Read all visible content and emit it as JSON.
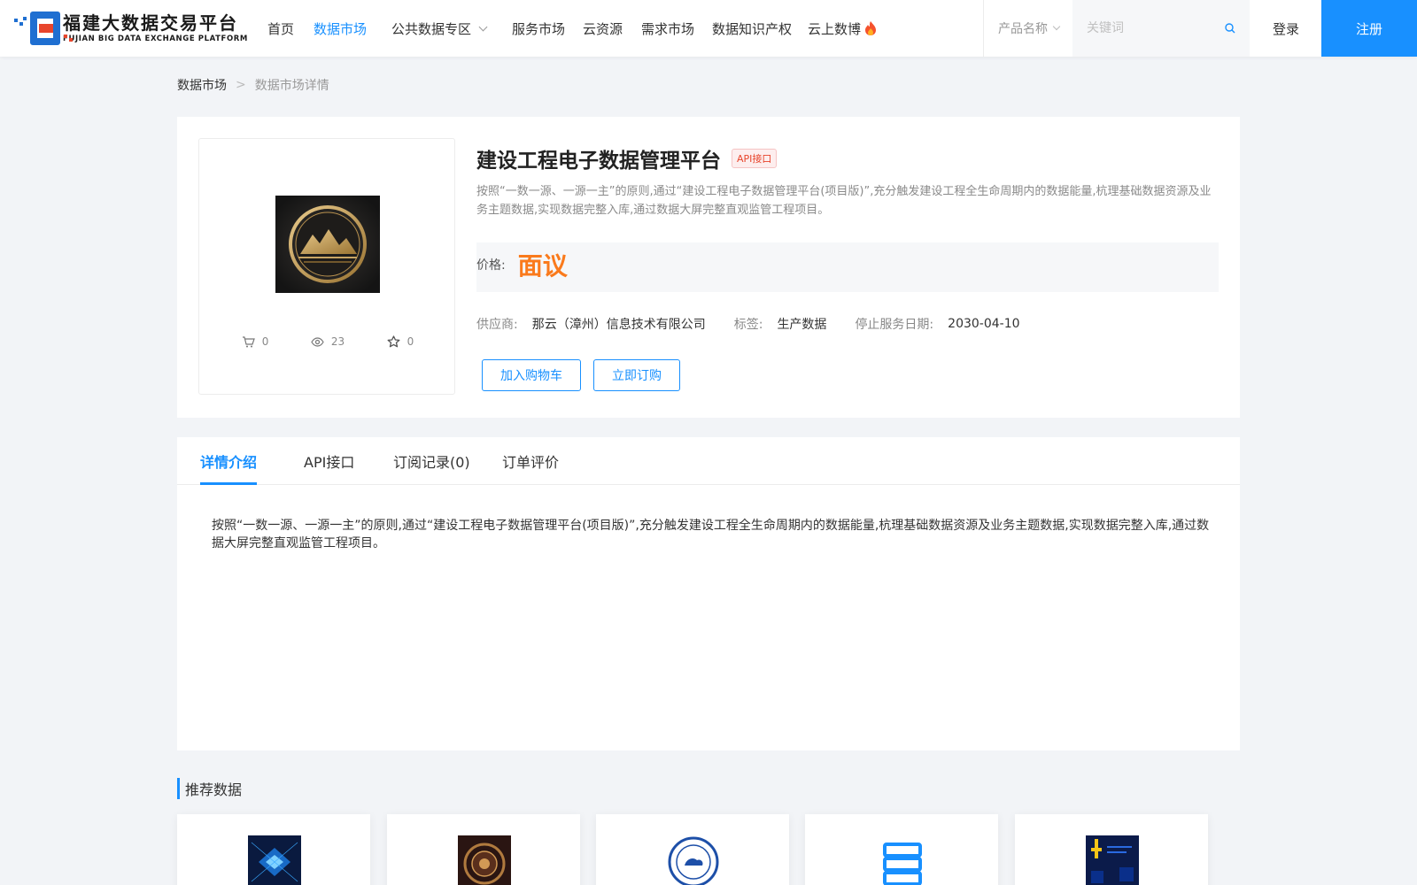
{
  "brand": {
    "name_cn": "福建大数据交易平台",
    "name_en": "FUJIAN BIG DATA EXCHANGE  PLATFORM",
    "primary_color": "#1f6fd1",
    "accent_color": "#e8452c"
  },
  "nav": {
    "items": [
      {
        "label": "首页",
        "active": false
      },
      {
        "label": "数据市场",
        "active": true
      },
      {
        "label": "公共数据专区",
        "active": false,
        "has_dropdown": true
      },
      {
        "label": "服务市场",
        "active": false
      },
      {
        "label": "云资源",
        "active": false
      },
      {
        "label": "需求市场",
        "active": false
      },
      {
        "label": "数据知识产权",
        "active": false
      },
      {
        "label": "云上数博",
        "active": false,
        "icon": "flame-icon"
      }
    ],
    "active_color": "#1890ff"
  },
  "search": {
    "category": "产品名称",
    "placeholder": "关键词",
    "value": ""
  },
  "auth": {
    "login_label": "登录",
    "register_label": "注册",
    "register_color": "#1890ff"
  },
  "breadcrumb": {
    "items": [
      "数据市场",
      "数据市场详情"
    ],
    "separator": ">"
  },
  "product": {
    "title": "建设工程电子数据管理平台",
    "badge": "API接口",
    "description": "按照“一数一源、一源一主”的原则,通过“建设工程电子数据管理平台(项目版)”,充分触发建设工程全生命周期内的数据能量,杭理基础数据资源及业务主题数据,实现数据完整入库,通过数据大屏完整直观监管工程项目。",
    "price_label": "价格:",
    "price_value": "面议",
    "price_color": "#fa7a1c",
    "supplier_label": "供应商:",
    "supplier": "那云（漳州）信息技术有限公司",
    "tag_label": "标签:",
    "tag": "生产数据",
    "end_date_label": "停止服务日期:",
    "end_date": "2030-04-10",
    "stats": {
      "cart": "0",
      "views": "23",
      "favorites": "0"
    },
    "add_cart_label": "加入购物车",
    "subscribe_label": "立即订购"
  },
  "tabs": {
    "items": [
      "详情介绍",
      "API接口",
      "订阅记录(0)",
      "订单评价"
    ],
    "active_index": 0,
    "content": "按照“一数一源、一源一主”的原则,通过“建设工程电子数据管理平台(项目版)”,充分触发建设工程全生命周期内的数据能量,杭理基础数据资源及业务主题数据,实现数据完整入库,通过数据大屏完整直观监管工程项目。"
  },
  "recommended": {
    "title": "推荐数据",
    "cards": [
      {
        "image": "blue-chip-thumbnail"
      },
      {
        "image": "bronze-emblem-thumbnail"
      },
      {
        "image": "weather-seal-thumbnail"
      },
      {
        "image": "server-rack-icon"
      },
      {
        "image": "data-chart-thumbnail"
      }
    ]
  }
}
